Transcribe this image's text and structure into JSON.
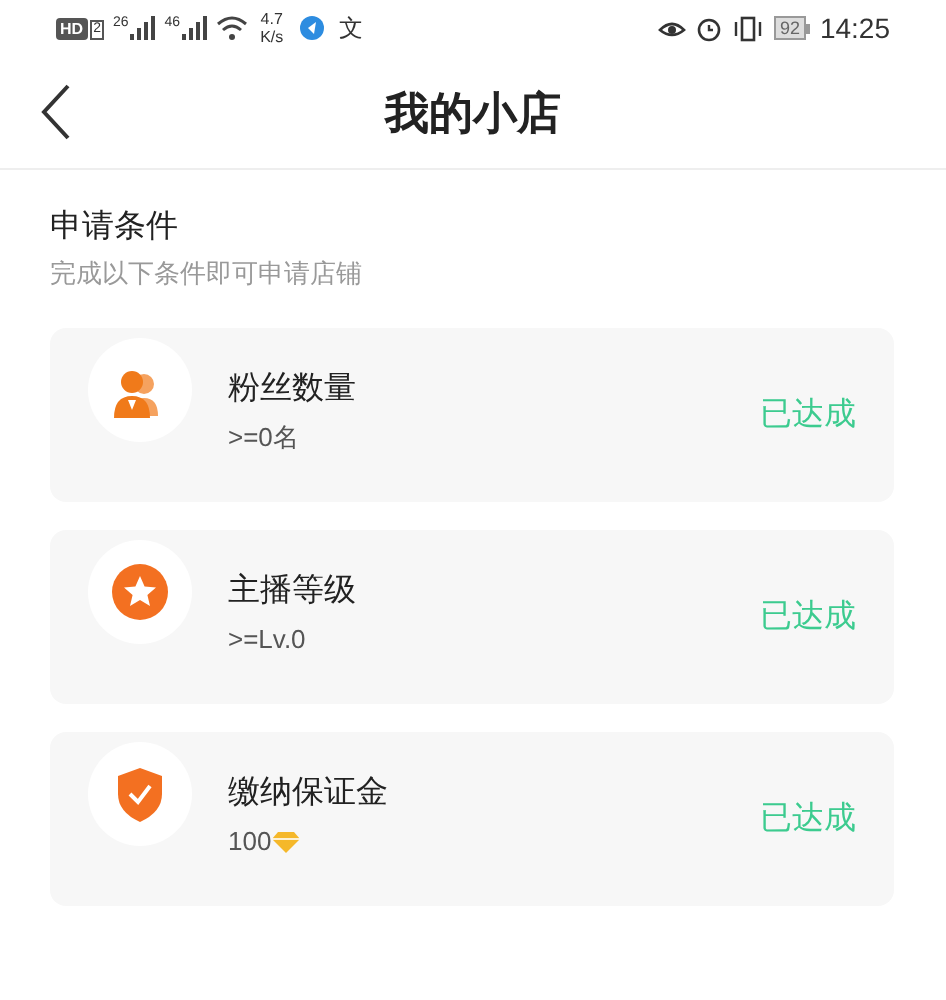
{
  "status_bar": {
    "hd": "HD",
    "hd_sub": "2",
    "sim1": "26",
    "sim2": "46",
    "speed": "4.7",
    "speed_unit": "K/s",
    "ime": "文",
    "battery": "92",
    "time": "14:25"
  },
  "header": {
    "title": "我的小店"
  },
  "section": {
    "title": "申请条件",
    "subtitle": "完成以下条件即可申请店铺"
  },
  "requirements": [
    {
      "kind": "fans",
      "title": "粉丝数量",
      "detail": ">=0名",
      "currency_icon": false,
      "status": "已达成",
      "achieved": true
    },
    {
      "kind": "level",
      "title": "主播等级",
      "detail": ">=Lv.0",
      "currency_icon": false,
      "status": "已达成",
      "achieved": true
    },
    {
      "kind": "deposit",
      "title": "缴纳保证金",
      "detail": "100",
      "currency_icon": true,
      "status": "已达成",
      "achieved": true
    }
  ]
}
